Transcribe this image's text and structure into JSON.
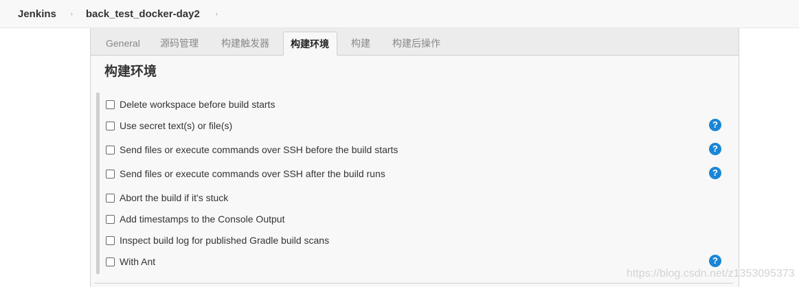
{
  "breadcrumb": {
    "root": "Jenkins",
    "job": "back_test_docker-day2",
    "separator": "›"
  },
  "tabs": [
    {
      "label": "General"
    },
    {
      "label": "源码管理"
    },
    {
      "label": "构建触发器"
    },
    {
      "label": "构建环境"
    },
    {
      "label": "构建"
    },
    {
      "label": "构建后操作"
    }
  ],
  "active_tab": "构建环境",
  "section": {
    "title": "构建环境"
  },
  "options": [
    {
      "label": "Delete workspace before build starts",
      "checked": false,
      "help": false
    },
    {
      "label": "Use secret text(s) or file(s)",
      "checked": false,
      "help": true
    },
    {
      "label": "Send files or execute commands over SSH before the build starts",
      "checked": false,
      "help": true
    },
    {
      "label": "Send files or execute commands over SSH after the build runs",
      "checked": false,
      "help": true
    },
    {
      "label": "Abort the build if it's stuck",
      "checked": false,
      "help": false
    },
    {
      "label": "Add timestamps to the Console Output",
      "checked": false,
      "help": false
    },
    {
      "label": "Inspect build log for published Gradle build scans",
      "checked": false,
      "help": false
    },
    {
      "label": "With Ant",
      "checked": false,
      "help": true
    }
  ],
  "help_icon_glyph": "?",
  "colors": {
    "help_icon": "#1a86d6",
    "active_tab_bg": "#f8f8f8",
    "tabbar_bg": "#ececec"
  },
  "watermark": "https://blog.csdn.net/z1353095373"
}
